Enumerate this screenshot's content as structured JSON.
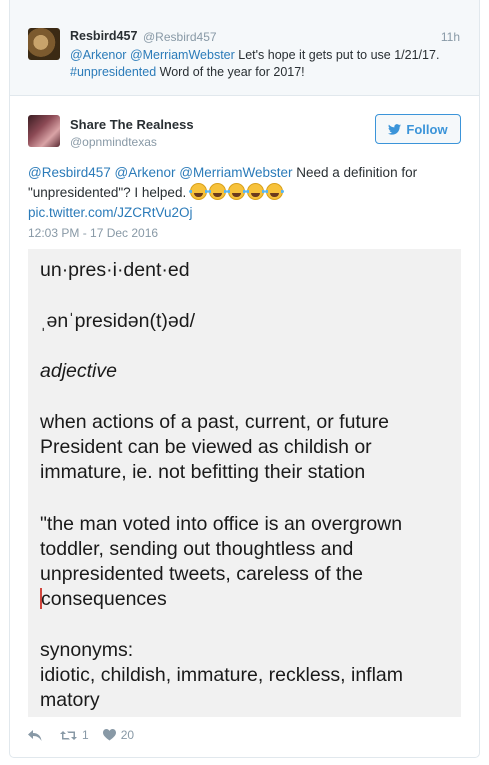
{
  "parent_tweet": {
    "name": "Resbird457",
    "handle": "@Resbird457",
    "time": "11h",
    "mention_1": "@Arkenor",
    "mention_2": "@MerriamWebster",
    "text_mid": " Let's hope it gets put to use 1/21/17.",
    "hashtag": "#unpresidented",
    "text_end": " Word of the year for 2017!"
  },
  "tweet": {
    "name": "Share The Realness",
    "handle": "@opnmindtexas",
    "follow_label": "Follow",
    "mention_1": "@Resbird457",
    "mention_2": "@Arkenor",
    "mention_3": "@MerriamWebster",
    "text": " Need a definition for \"unpresidented\"? I helped. ",
    "emoji_count": 5,
    "pic_link": "pic.twitter.com/JZCRtVu2Oj",
    "timestamp": "12:03 PM - 17 Dec 2016"
  },
  "definition_card": {
    "headword": "un·pres·i·dent·ed",
    "pronunciation": "ˌənˈpresidən(t)əd/",
    "part_of_speech": "adjective",
    "definition_lines": [
      "when actions of a past, current, or future",
      "President can be viewed as childish or",
      "immature, ie. not befitting their station"
    ],
    "example_lines": [
      "\"the man voted into office is an overgrown",
      "toddler, sending out thoughtless and",
      "unpresidented tweets, careless of the",
      "consequences"
    ],
    "synonyms_label": "synonyms:",
    "synonyms_lines": [
      "idiotic, childish, immature, reckless, inflam",
      "matory"
    ]
  },
  "actions": {
    "retweet_count": "1",
    "like_count": "20",
    "icon_color": "#8899a6"
  }
}
